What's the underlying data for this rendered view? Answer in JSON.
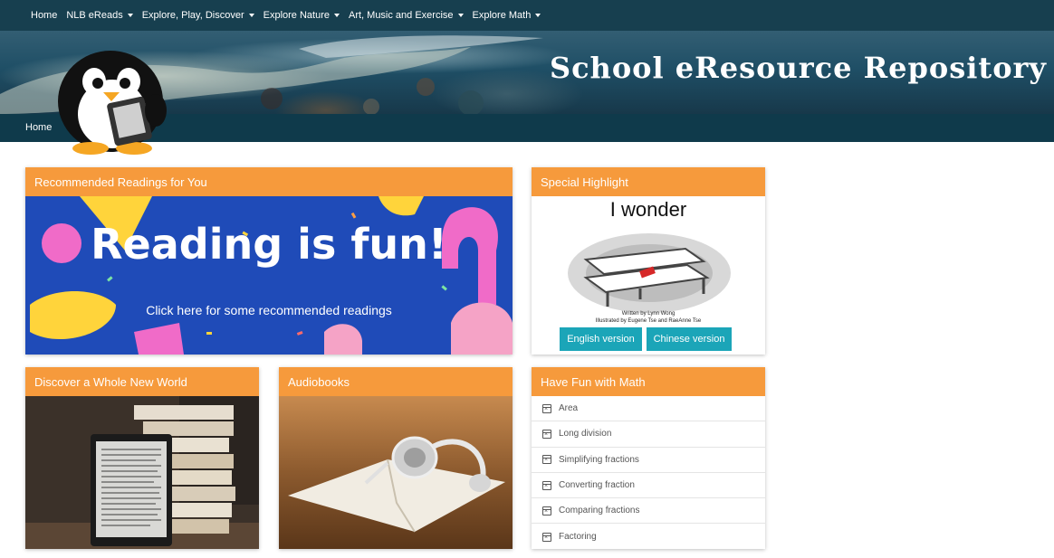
{
  "nav": {
    "items": [
      {
        "label": "Home",
        "dropdown": false
      },
      {
        "label": "NLB eReads",
        "dropdown": true
      },
      {
        "label": "Explore, Play, Discover",
        "dropdown": true
      },
      {
        "label": "Explore Nature",
        "dropdown": true
      },
      {
        "label": "Art, Music and Exercise",
        "dropdown": true
      },
      {
        "label": "Explore Math",
        "dropdown": true
      }
    ]
  },
  "banner": {
    "title": "School eResource Repository"
  },
  "breadcrumb": {
    "current": "Home"
  },
  "cards": {
    "recommended": {
      "header": "Recommended Readings for You",
      "image_title": "Reading is fun!",
      "image_subtitle": "Click here for some recommended readings"
    },
    "highlight": {
      "header": "Special Highlight",
      "book_title": "I wonder",
      "author_line": "Written by Lynn Wong",
      "illustrator_line": "Illustrated by Eugene Tse and RaeAnne Tse",
      "english_button": "English version",
      "chinese_button": "Chinese version"
    },
    "discover": {
      "header": "Discover a Whole New World"
    },
    "audiobooks": {
      "header": "Audiobooks"
    },
    "math": {
      "header": "Have Fun with Math",
      "items": [
        "Area",
        "Long division",
        "Simplifying fractions",
        "Converting fraction",
        "Comparing fractions",
        "Factoring"
      ],
      "item_icon": "calendar-x-icon"
    }
  },
  "colors": {
    "nav_bg": "#173f4f",
    "card_header": "#f69a3c",
    "button": "#1ba5b8"
  }
}
